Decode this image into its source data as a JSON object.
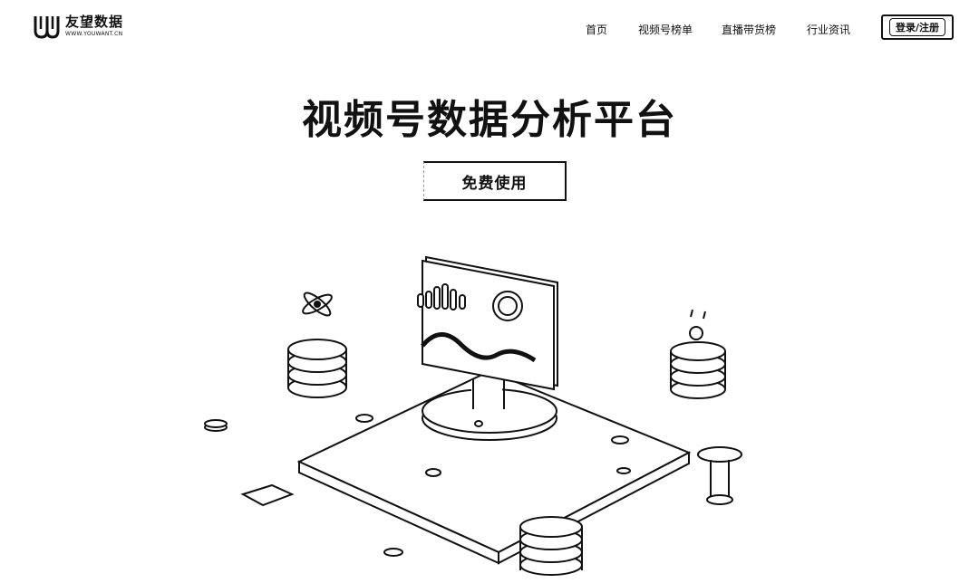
{
  "brand": {
    "name": "友望数据",
    "url_text": "WWW.YOUWANT.CN"
  },
  "nav": {
    "items": [
      "首页",
      "视频号榜单",
      "直播带货榜",
      "行业资讯"
    ],
    "login_label": "登录/注册"
  },
  "hero": {
    "title": "视频号数据分析平台",
    "cta_label": "免费使用"
  },
  "colors": {
    "text": "#111111",
    "background": "#ffffff"
  }
}
